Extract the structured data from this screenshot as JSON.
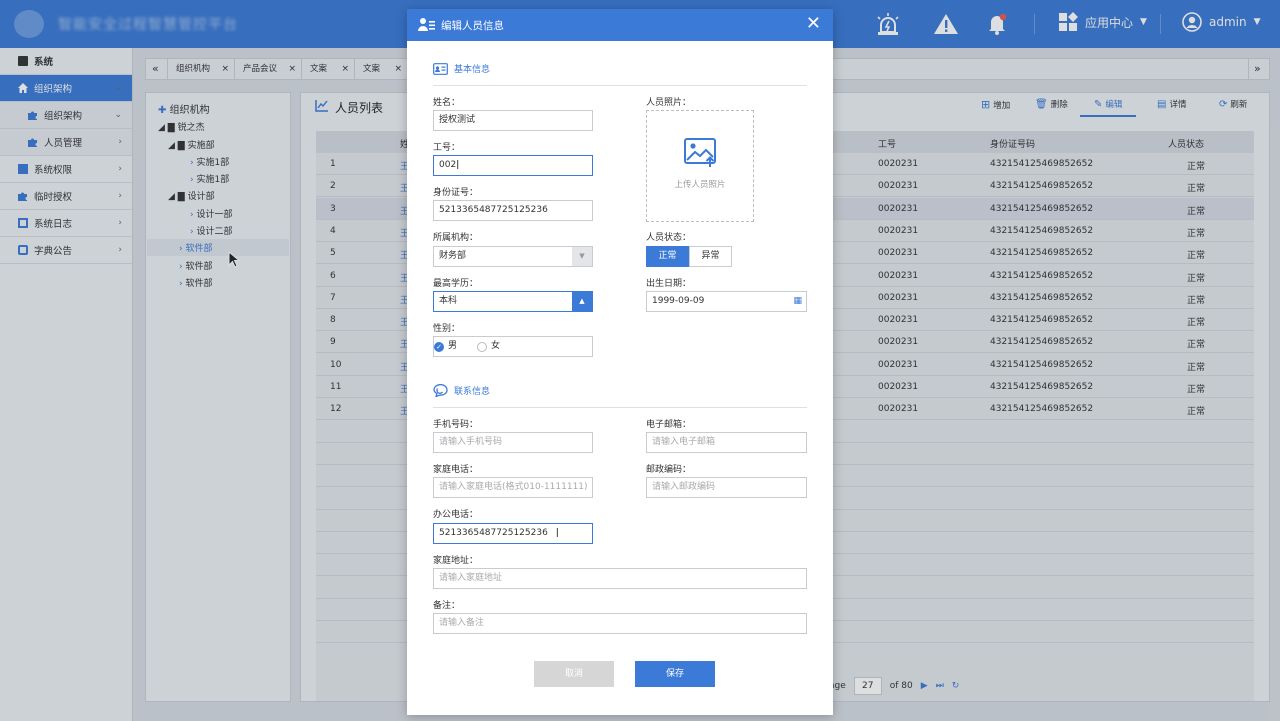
{
  "header": {
    "app_title": "智能安全过程智慧管控平台",
    "app_center": "应用中心",
    "user": "admin"
  },
  "sidebar": {
    "items": [
      {
        "label": "系统"
      },
      {
        "label": "组织架构"
      },
      {
        "label": "组织架构"
      },
      {
        "label": "人员管理"
      },
      {
        "label": "系统权限"
      },
      {
        "label": "临时授权"
      },
      {
        "label": "系统日志"
      },
      {
        "label": "字典公告"
      }
    ]
  },
  "tabs": [
    {
      "label": "组织机构"
    },
    {
      "label": "产品会议"
    },
    {
      "label": "文案"
    },
    {
      "label": "文案"
    }
  ],
  "tree": {
    "title": "组织机构",
    "nodes": [
      "锐之杰",
      "实施部",
      "实施1部",
      "实施1部",
      "设计部",
      "设计一部",
      "设计二部",
      "软件部",
      "软件部",
      "软件部"
    ]
  },
  "main": {
    "title": "人员列表",
    "toolbar": {
      "add": "增加",
      "delete": "删除",
      "edit": "编辑",
      "detail": "详情",
      "refresh": "刷新"
    },
    "columns": {
      "name": "姓",
      "emp_no": "工号",
      "id_no": "身份证号码",
      "status": "人员状态"
    },
    "rows": [
      {
        "idx": "1",
        "name": "王",
        "emp_no": "0020231",
        "id_no": "432154125469852652",
        "status": "正常"
      },
      {
        "idx": "2",
        "name": "王",
        "emp_no": "0020231",
        "id_no": "432154125469852652",
        "status": "正常"
      },
      {
        "idx": "3",
        "name": "王",
        "emp_no": "0020231",
        "id_no": "432154125469852652",
        "status": "正常"
      },
      {
        "idx": "4",
        "name": "王",
        "emp_no": "0020231",
        "id_no": "432154125469852652",
        "status": "正常"
      },
      {
        "idx": "5",
        "name": "王",
        "emp_no": "0020231",
        "id_no": "432154125469852652",
        "status": "正常"
      },
      {
        "idx": "6",
        "name": "王",
        "emp_no": "0020231",
        "id_no": "432154125469852652",
        "status": "正常"
      },
      {
        "idx": "7",
        "name": "王",
        "emp_no": "0020231",
        "id_no": "432154125469852652",
        "status": "正常"
      },
      {
        "idx": "8",
        "name": "王",
        "emp_no": "0020231",
        "id_no": "432154125469852652",
        "status": "正常"
      },
      {
        "idx": "9",
        "name": "王",
        "emp_no": "0020231",
        "id_no": "432154125469852652",
        "status": "正常"
      },
      {
        "idx": "10",
        "name": "王",
        "emp_no": "0020231",
        "id_no": "432154125469852652",
        "status": "正常"
      },
      {
        "idx": "11",
        "name": "王",
        "emp_no": "0020231",
        "id_no": "432154125469852652",
        "status": "正常"
      },
      {
        "idx": "12",
        "name": "王",
        "emp_no": "0020231",
        "id_no": "432154125469852652",
        "status": "正常"
      }
    ],
    "pager": {
      "prefix": "age",
      "page": "27",
      "of": "of 80"
    }
  },
  "modal": {
    "title": "编辑人员信息",
    "basic_section": "基本信息",
    "contact_section": "联系信息",
    "fields": {
      "name": {
        "label": "姓名：",
        "value": "授权测试"
      },
      "emp_no": {
        "label": "工号：",
        "value": "002"
      },
      "id_no": {
        "label": "身份证号：",
        "value": "5213365487725125236"
      },
      "org": {
        "label": "所属机构：",
        "value": "财务部"
      },
      "edu": {
        "label": "最高学历：",
        "value": "本科"
      },
      "gender": {
        "label": "性别：",
        "male": "男",
        "female": "女"
      },
      "photo": {
        "label": "人员照片：",
        "upload": "上传人员照片"
      },
      "status": {
        "label": "人员状态：",
        "normal": "正常",
        "abnormal": "异常"
      },
      "birth": {
        "label": "出生日期：",
        "value": "1999-09-09"
      },
      "mobile": {
        "label": "手机号码：",
        "placeholder": "请输入手机号码"
      },
      "email": {
        "label": "电子邮箱：",
        "placeholder": "请输入电子邮箱"
      },
      "home_tel": {
        "label": "家庭电话：",
        "placeholder": "请输入家庭电话(格式010-1111111)"
      },
      "zip": {
        "label": "邮政编码：",
        "placeholder": "请输入邮政编码"
      },
      "office_tel": {
        "label": "办公电话：",
        "value": "5213365487725125236"
      },
      "address": {
        "label": "家庭地址：",
        "placeholder": "请输入家庭地址"
      },
      "remark": {
        "label": "备注：",
        "placeholder": "请输入备注"
      }
    },
    "cancel": "取消",
    "save": "保存"
  },
  "colors": {
    "accent": "#3b7ad6",
    "cancel_bg": "#d6d6d6"
  }
}
